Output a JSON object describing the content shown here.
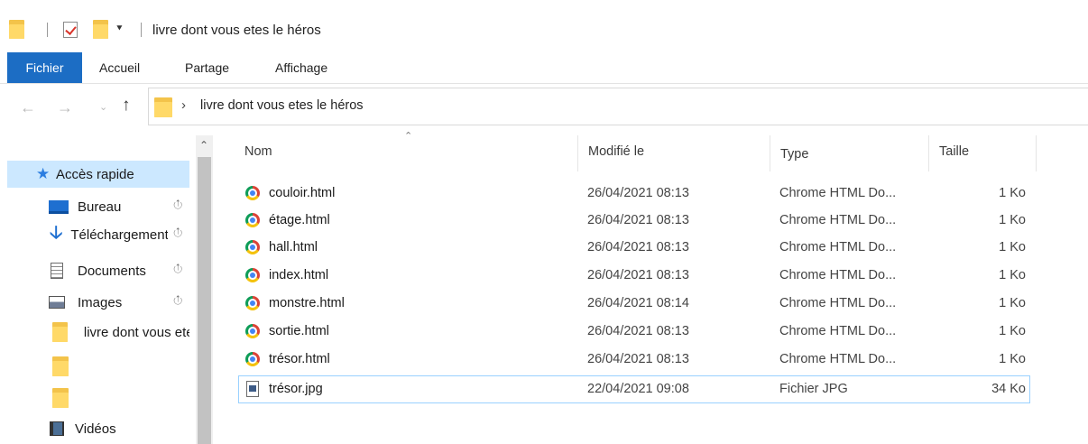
{
  "window": {
    "title": "livre dont vous etes le héros"
  },
  "ribbon": {
    "tabs": [
      "Fichier",
      "Accueil",
      "Partage",
      "Affichage"
    ]
  },
  "address": {
    "path": "livre dont vous etes le héros"
  },
  "sidebar": {
    "items": [
      {
        "label": "Accès rapide",
        "icon": "star-icon",
        "selected": true
      },
      {
        "label": "Bureau",
        "icon": "desktop-icon",
        "pinned": true
      },
      {
        "label": "Téléchargements",
        "icon": "download-arrow-icon",
        "pinned": true
      },
      {
        "label": "Documents",
        "icon": "documents-icon",
        "pinned": true
      },
      {
        "label": "Images",
        "icon": "images-icon",
        "pinned": true
      },
      {
        "label": "livre dont vous etes le héros",
        "icon": "folder-icon"
      },
      {
        "label": "",
        "icon": "folder-icon"
      },
      {
        "label": "",
        "icon": "folder-icon"
      },
      {
        "label": "Vidéos",
        "icon": "video-icon"
      }
    ]
  },
  "columns": {
    "name": "Nom",
    "modified": "Modifié le",
    "type": "Type",
    "size": "Taille"
  },
  "files": [
    {
      "name": "couloir.html",
      "modified": "26/04/2021 08:13",
      "type": "Chrome HTML Do...",
      "size": "1 Ko",
      "icon": "chrome-icon"
    },
    {
      "name": "étage.html",
      "modified": "26/04/2021 08:13",
      "type": "Chrome HTML Do...",
      "size": "1 Ko",
      "icon": "chrome-icon"
    },
    {
      "name": "hall.html",
      "modified": "26/04/2021 08:13",
      "type": "Chrome HTML Do...",
      "size": "1 Ko",
      "icon": "chrome-icon"
    },
    {
      "name": "index.html",
      "modified": "26/04/2021 08:13",
      "type": "Chrome HTML Do...",
      "size": "1 Ko",
      "icon": "chrome-icon"
    },
    {
      "name": "monstre.html",
      "modified": "26/04/2021 08:14",
      "type": "Chrome HTML Do...",
      "size": "1 Ko",
      "icon": "chrome-icon"
    },
    {
      "name": "sortie.html",
      "modified": "26/04/2021 08:13",
      "type": "Chrome HTML Do...",
      "size": "1 Ko",
      "icon": "chrome-icon"
    },
    {
      "name": "trésor.html",
      "modified": "26/04/2021 08:13",
      "type": "Chrome HTML Do...",
      "size": "1 Ko",
      "icon": "chrome-icon"
    },
    {
      "name": "trésor.jpg",
      "modified": "22/04/2021 09:08",
      "type": "Fichier JPG",
      "size": "34 Ko",
      "icon": "jpg-file-icon",
      "selected": true
    }
  ],
  "colors": {
    "accent": "#1c6dc4",
    "selection": "#cce8ff",
    "selection_border": "#99d1ff",
    "folder": "#ffd968"
  }
}
